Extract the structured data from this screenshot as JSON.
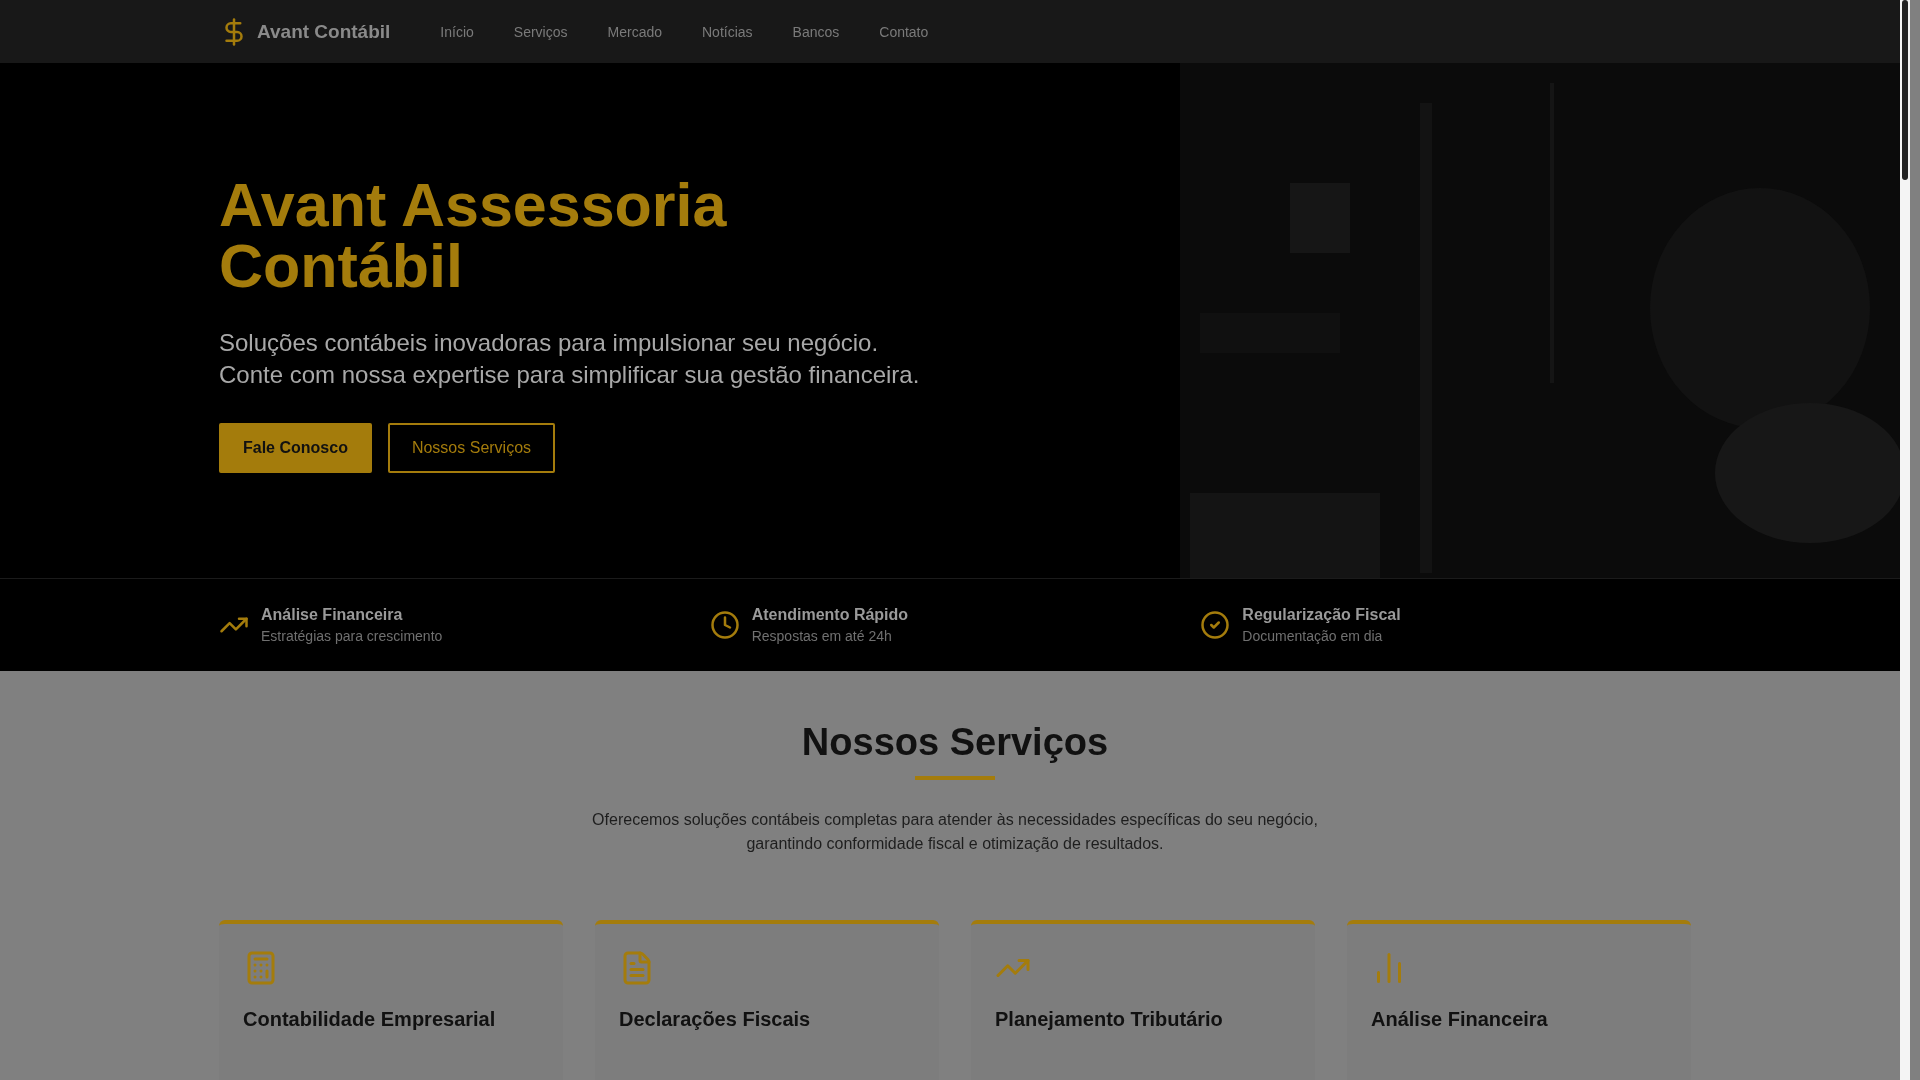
{
  "nav": {
    "brand": "Avant Contábil",
    "links": [
      {
        "label": "Início",
        "selected": false
      },
      {
        "label": "Serviços",
        "selected": false
      },
      {
        "label": "Mercado",
        "selected": false
      },
      {
        "label": "Notícias",
        "selected": false
      },
      {
        "label": "Bancos",
        "selected": false
      },
      {
        "label": "Contato",
        "selected": false
      }
    ]
  },
  "hero": {
    "title": "Avant Assessoria Contábil",
    "subtitle_lines": [
      "Soluções contábeis inovadoras para impulsionar seu negócio.",
      "Conte com nossa expertise para simplificar sua gestão financeira."
    ],
    "buttons": [
      {
        "label": "Fale Conosco",
        "kind": "primary"
      },
      {
        "label": "Nossos Serviços",
        "kind": "outline"
      }
    ]
  },
  "features": [
    {
      "title": "Análise Financeira",
      "subtitle": "Estratégias para crescimento"
    },
    {
      "title": "Atendimento Rápido",
      "subtitle": "Respostas em até 24h"
    },
    {
      "title": "Regularização Fiscal",
      "subtitle": "Documentação em dia"
    }
  ],
  "services": {
    "heading": "Nossos Serviços",
    "intro_lines": [
      "Oferecemos soluções contábeis completas para atender às necessidades específicas do seu negócio,",
      "garantindo conformidade fiscal e otimização de resultados."
    ],
    "cards": [
      {
        "title": "Contabilidade Empresarial"
      },
      {
        "title": "Declarações Fiscais"
      },
      {
        "title": "Planejamento Tributário"
      },
      {
        "title": "Análise Financeira"
      }
    ]
  }
}
